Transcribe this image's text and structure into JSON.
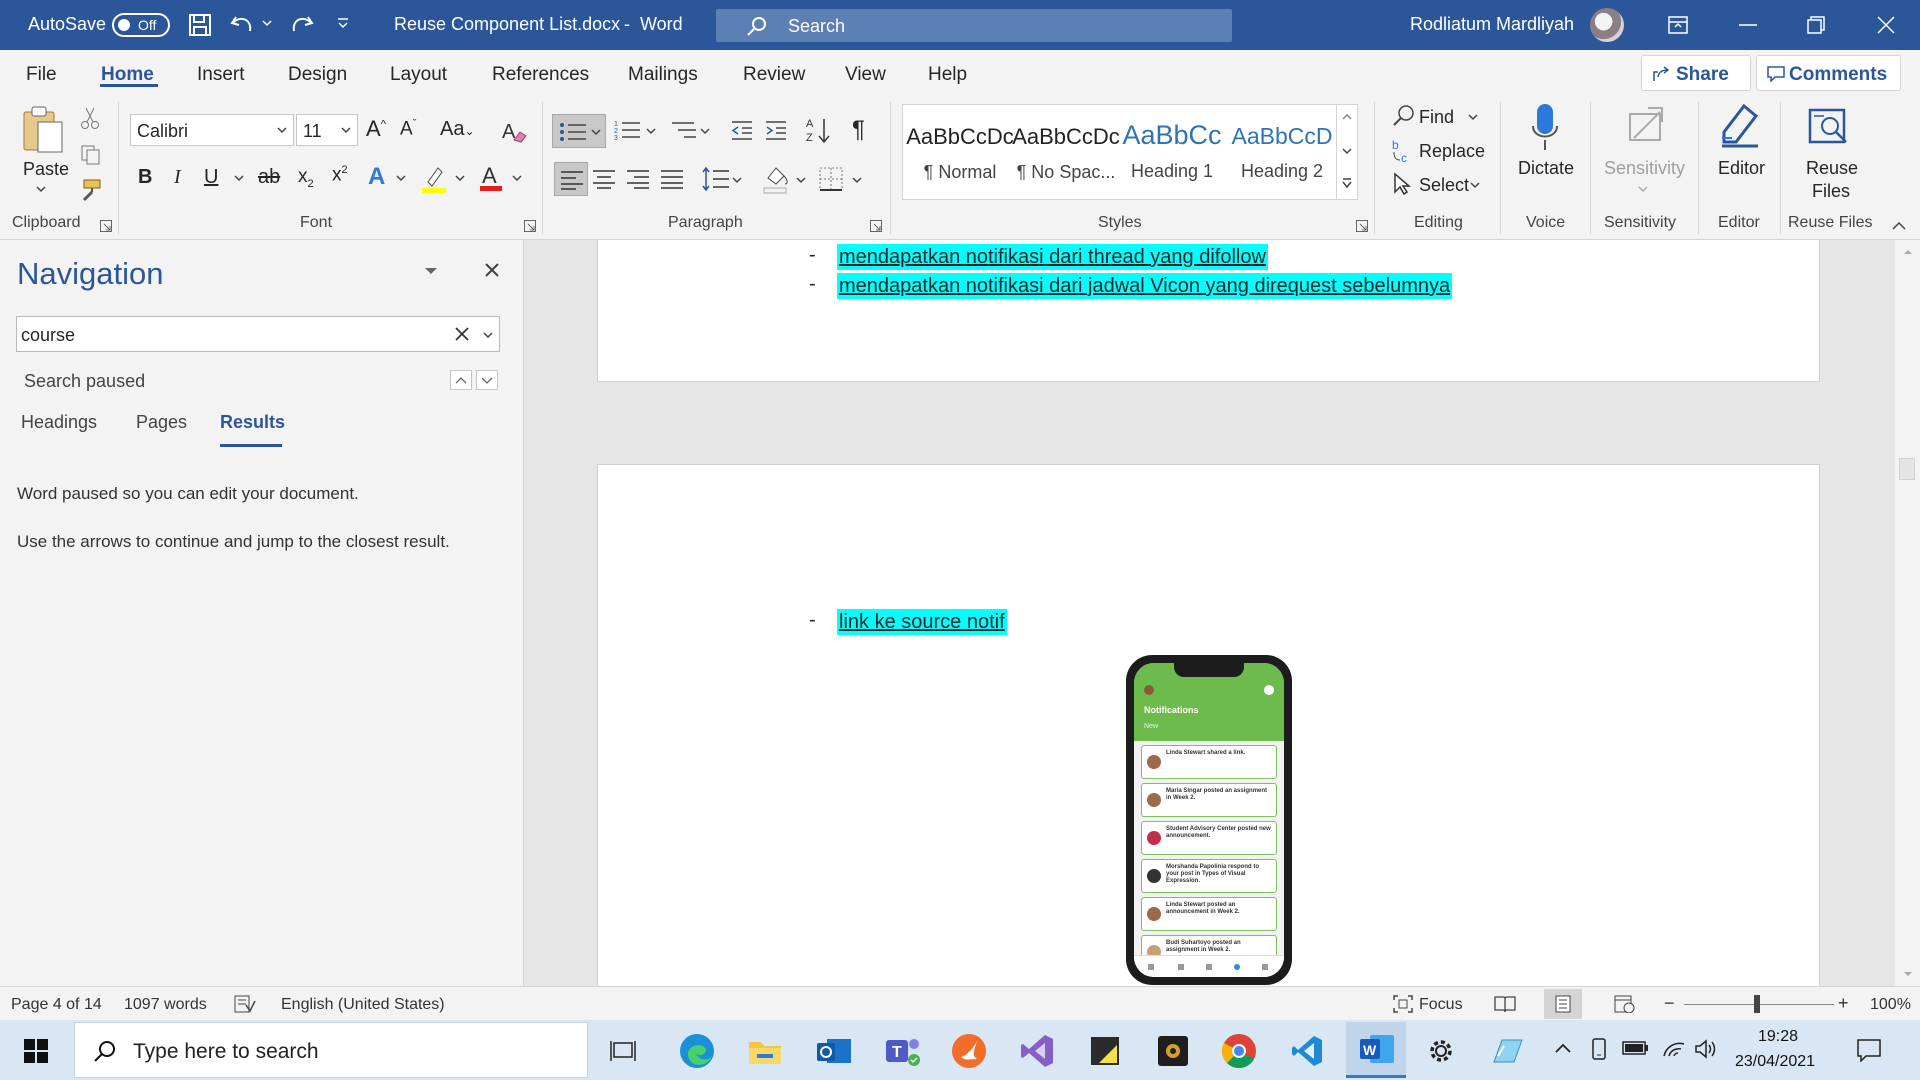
{
  "titlebar": {
    "autosave_label": "AutoSave",
    "autosave_state": "Off",
    "doc_title": "Reuse Component List.docx",
    "separator": "-",
    "app_name": "Word",
    "search_placeholder": "Search",
    "user_name": "Rodliatum Mardliyah"
  },
  "tabs": [
    "File",
    "Home",
    "Insert",
    "Design",
    "Layout",
    "References",
    "Mailings",
    "Review",
    "View",
    "Help"
  ],
  "share_label": "Share",
  "comments_label": "Comments",
  "ribbon": {
    "clipboard": {
      "paste": "Paste",
      "group": "Clipboard"
    },
    "font": {
      "name": "Calibri",
      "size": "11",
      "group": "Font"
    },
    "paragraph": {
      "group": "Paragraph"
    },
    "styles": {
      "group": "Styles",
      "items": [
        {
          "preview": "AaBbCcDc",
          "name": "¶ Normal"
        },
        {
          "preview": "AaBbCcDc",
          "name": "¶ No Spac..."
        },
        {
          "preview": "AaBbCc",
          "name": "Heading 1"
        },
        {
          "preview": "AaBbCcD",
          "name": "Heading 2"
        }
      ]
    },
    "editing": {
      "find": "Find",
      "replace": "Replace",
      "select": "Select",
      "group": "Editing"
    },
    "voice": {
      "dictate": "Dictate",
      "group": "Voice"
    },
    "sensitivity": {
      "label": "Sensitivity",
      "group": "Sensitivity"
    },
    "editor": {
      "label": "Editor",
      "group": "Editor"
    },
    "reuse": {
      "label1": "Reuse",
      "label2": "Files",
      "group": "Reuse Files"
    }
  },
  "navigation": {
    "title": "Navigation",
    "search_value": "course",
    "status": "Search paused",
    "tabs": [
      "Headings",
      "Pages",
      "Results"
    ],
    "active_tab": "Results",
    "message1": "Word paused so you can edit your document.",
    "message2": "Use the arrows to continue and jump to the closest result."
  },
  "document": {
    "page1_items": [
      "mendapatkan notifikasi dari thread yang difollow",
      "mendapatkan notifikasi dari jadwal Vicon yang direquest sebelumnya"
    ],
    "page2_items": [
      "link ke source notif"
    ],
    "bullet": "-",
    "phone": {
      "header": "Notifications",
      "subheader": "New",
      "notifications": [
        "Linda Stewart shared a link.",
        "Maria Singar posted an assignment in Week 2.",
        "Student Advisory Center posted new announcement.",
        "Morshanda Papolinia respond to your post in Types of Visual Expression.",
        "Linda Stewart posted an announcement in Week 2.",
        "Budi Suhartoyo posted an assignment in Week 2."
      ]
    }
  },
  "status": {
    "page": "Page 4 of 14",
    "words": "1097 words",
    "language": "English (United States)",
    "focus": "Focus",
    "zoom": "100%",
    "zoom_minus": "−",
    "zoom_plus": "+"
  },
  "taskbar": {
    "search_placeholder": "Type here to search",
    "time": "19:28",
    "date": "23/04/2021"
  },
  "colors": {
    "word_blue": "#2b579a",
    "highlight": "#00ffff",
    "phone_green": "#6dbb4c"
  }
}
